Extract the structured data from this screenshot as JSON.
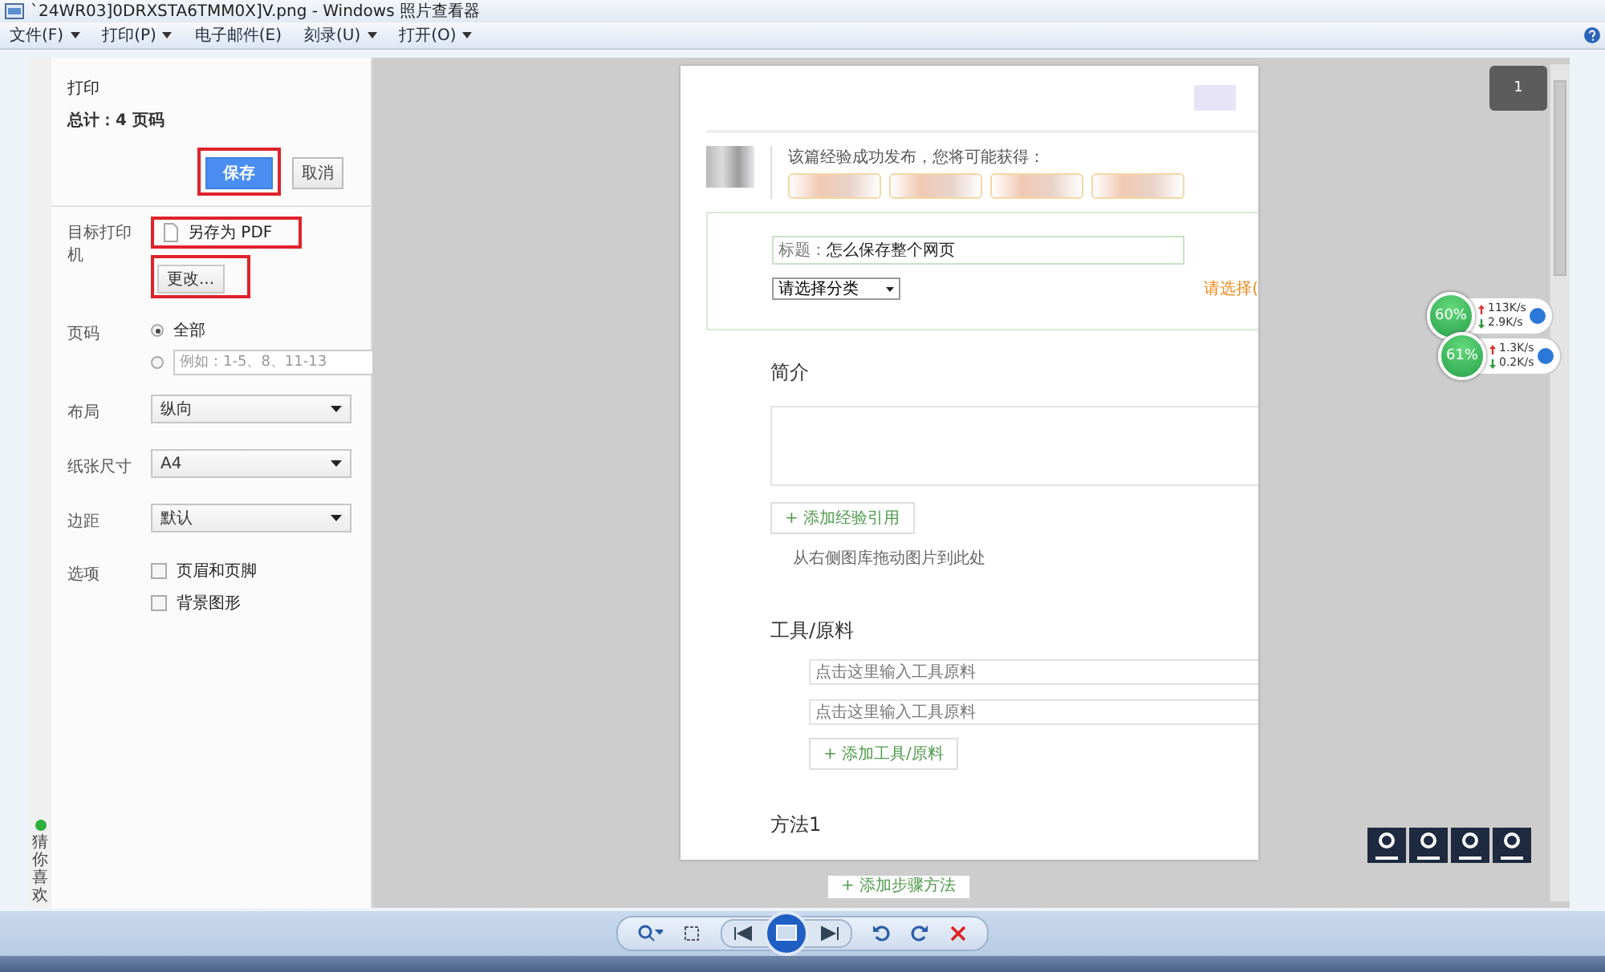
{
  "window": {
    "title": "`24WR03]0DRXSTA6TMM0X]V.png - Windows 照片查看器"
  },
  "menu": [
    {
      "label": "文件(F)",
      "has_menu": true
    },
    {
      "label": "打印(P)",
      "has_menu": true
    },
    {
      "label": "电子邮件(E)",
      "has_menu": false
    },
    {
      "label": "刻录(U)",
      "has_menu": true
    },
    {
      "label": "打开(O)",
      "has_menu": true
    }
  ],
  "side_strip": {
    "label": "猜你喜欢"
  },
  "print_panel": {
    "title": "打印",
    "total": "总计：4 页码",
    "buttons": [
      {
        "label": "保存",
        "kind": "primary",
        "highlighted": true
      },
      {
        "label": "取消",
        "kind": "plain",
        "highlighted": false
      }
    ],
    "destination": {
      "label": "目标打印机",
      "printer": "另存为 PDF",
      "printer_highlighted": true,
      "change_button": "更改...",
      "change_highlighted": true
    },
    "pages": {
      "label": "页码",
      "options": [
        {
          "kind": "all",
          "label": "全部",
          "selected": true
        },
        {
          "kind": "range",
          "placeholder": "例如：1-5、8、11-13",
          "selected": false
        }
      ]
    },
    "selects": [
      {
        "label": "布局",
        "value": "纵向"
      },
      {
        "label": "纸张尺寸",
        "value": "A4"
      },
      {
        "label": "边距",
        "value": "默认"
      }
    ],
    "options": {
      "label": "选项",
      "items": [
        {
          "label": "页眉和页脚",
          "checked": false
        },
        {
          "label": "背景图形",
          "checked": false
        }
      ]
    }
  },
  "preview": {
    "page_number": "1",
    "page": {
      "notice": "该篇经验成功发布，您将可能获得：",
      "title_label": "标题：",
      "title_value": "怎么保存整个网页",
      "category": "请选择分类",
      "category_hint": "请选择(",
      "intro_heading": "简介",
      "quote_button": "+ 添加经验引用",
      "drag_hint": "从右侧图库拖动图片到此处",
      "tools_heading": "工具/原料",
      "tool_placeholders": [
        "点击这里输入工具原料",
        "点击这里输入工具原料"
      ],
      "tools_button": "+ 添加工具/原料",
      "method_heading": "方法1"
    },
    "below_page": "+ 添加步骤方法"
  },
  "net_monitors": [
    {
      "percent": "60%",
      "up": "113K/s",
      "down": "2.9K/s"
    },
    {
      "percent": "61%",
      "up": "1.3K/s",
      "down": "0.2K/s"
    }
  ]
}
